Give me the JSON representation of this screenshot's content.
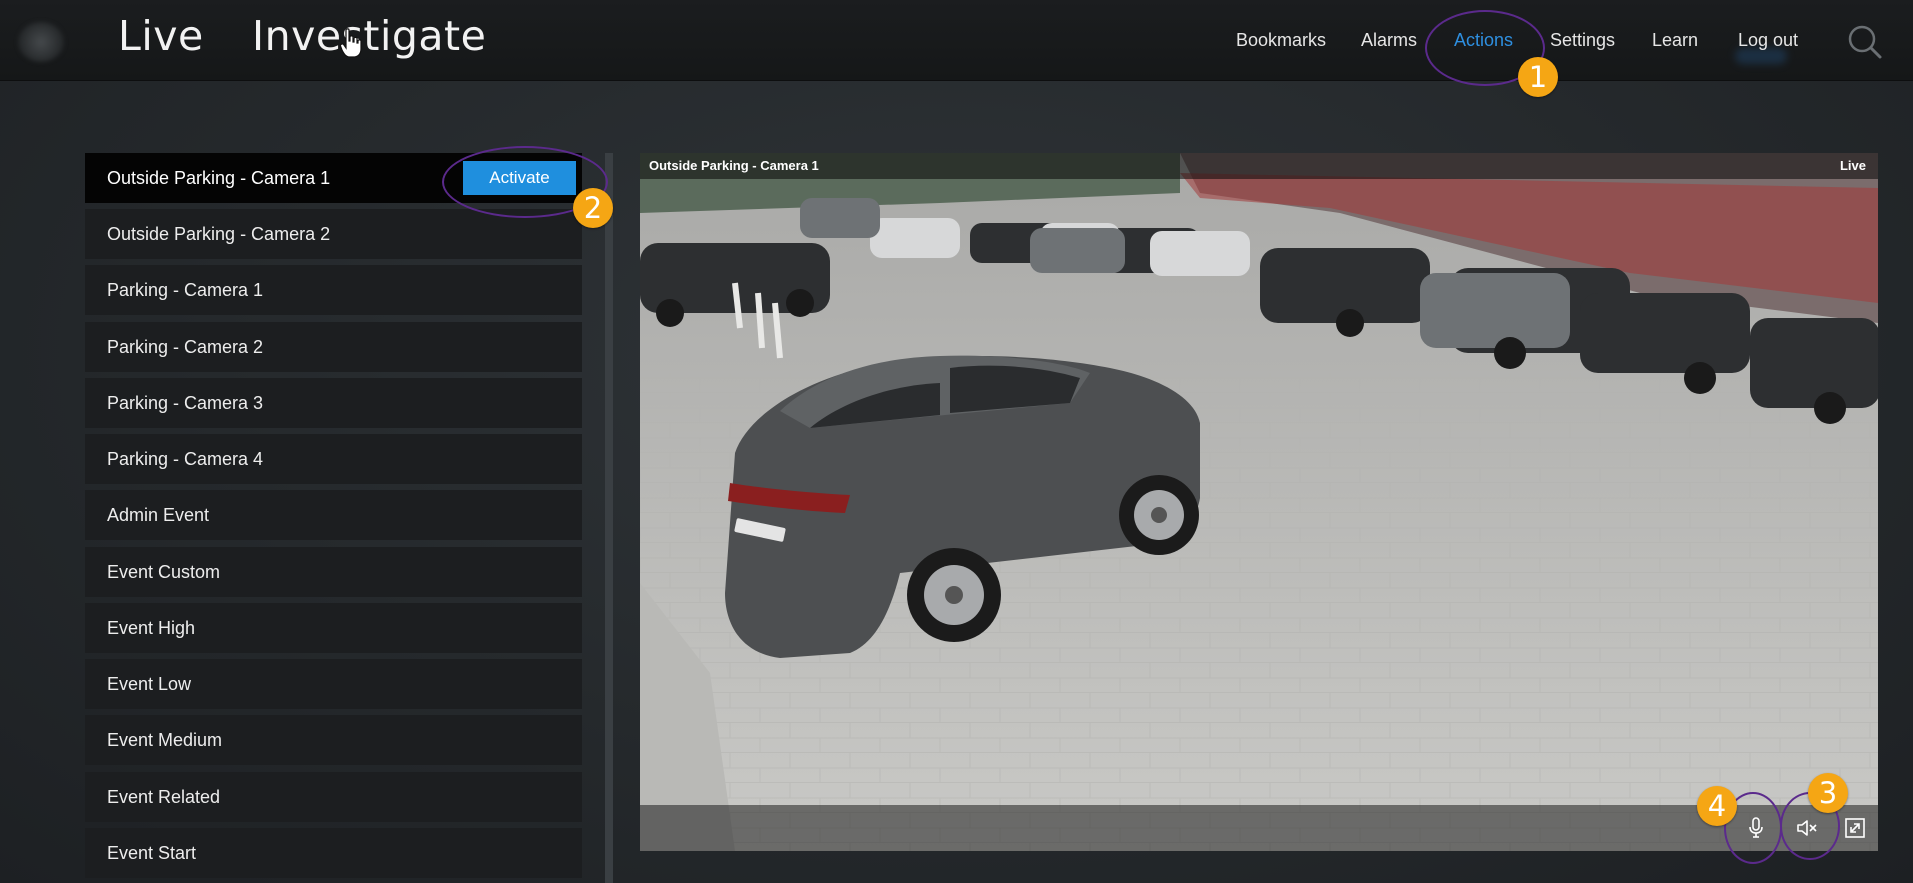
{
  "header": {
    "tabs": [
      {
        "label": "Live"
      },
      {
        "label": "Investigate"
      }
    ],
    "nav": [
      {
        "label": "Bookmarks"
      },
      {
        "label": "Alarms"
      },
      {
        "label": "Actions",
        "active": true
      },
      {
        "label": "Settings"
      },
      {
        "label": "Learn"
      },
      {
        "label": "Log out"
      }
    ]
  },
  "sidebar": {
    "items": [
      {
        "label": "Outside Parking - Camera 1",
        "selected": true
      },
      {
        "label": "Outside Parking - Camera 2"
      },
      {
        "label": "Parking - Camera 1"
      },
      {
        "label": "Parking - Camera 2"
      },
      {
        "label": "Parking - Camera 3"
      },
      {
        "label": "Parking - Camera 4"
      },
      {
        "label": "Admin Event"
      },
      {
        "label": "Event Custom"
      },
      {
        "label": "Event High"
      },
      {
        "label": "Event Low"
      },
      {
        "label": "Event Medium"
      },
      {
        "label": "Event Related"
      },
      {
        "label": "Event Start"
      }
    ],
    "activate_label": "Activate"
  },
  "video": {
    "title": "Outside Parking - Camera 1",
    "live_label": "Live"
  },
  "callouts": [
    "1",
    "2",
    "3",
    "4"
  ],
  "colors": {
    "accent": "#1f8fde",
    "active_nav": "#2e8fe0",
    "callout_badge": "#f5a614",
    "callout_ring": "#5b2a8c"
  },
  "icons": {
    "search": "search-icon",
    "microphone": "microphone-icon",
    "speaker_muted": "speaker-muted-icon",
    "fullscreen": "fullscreen-icon"
  }
}
